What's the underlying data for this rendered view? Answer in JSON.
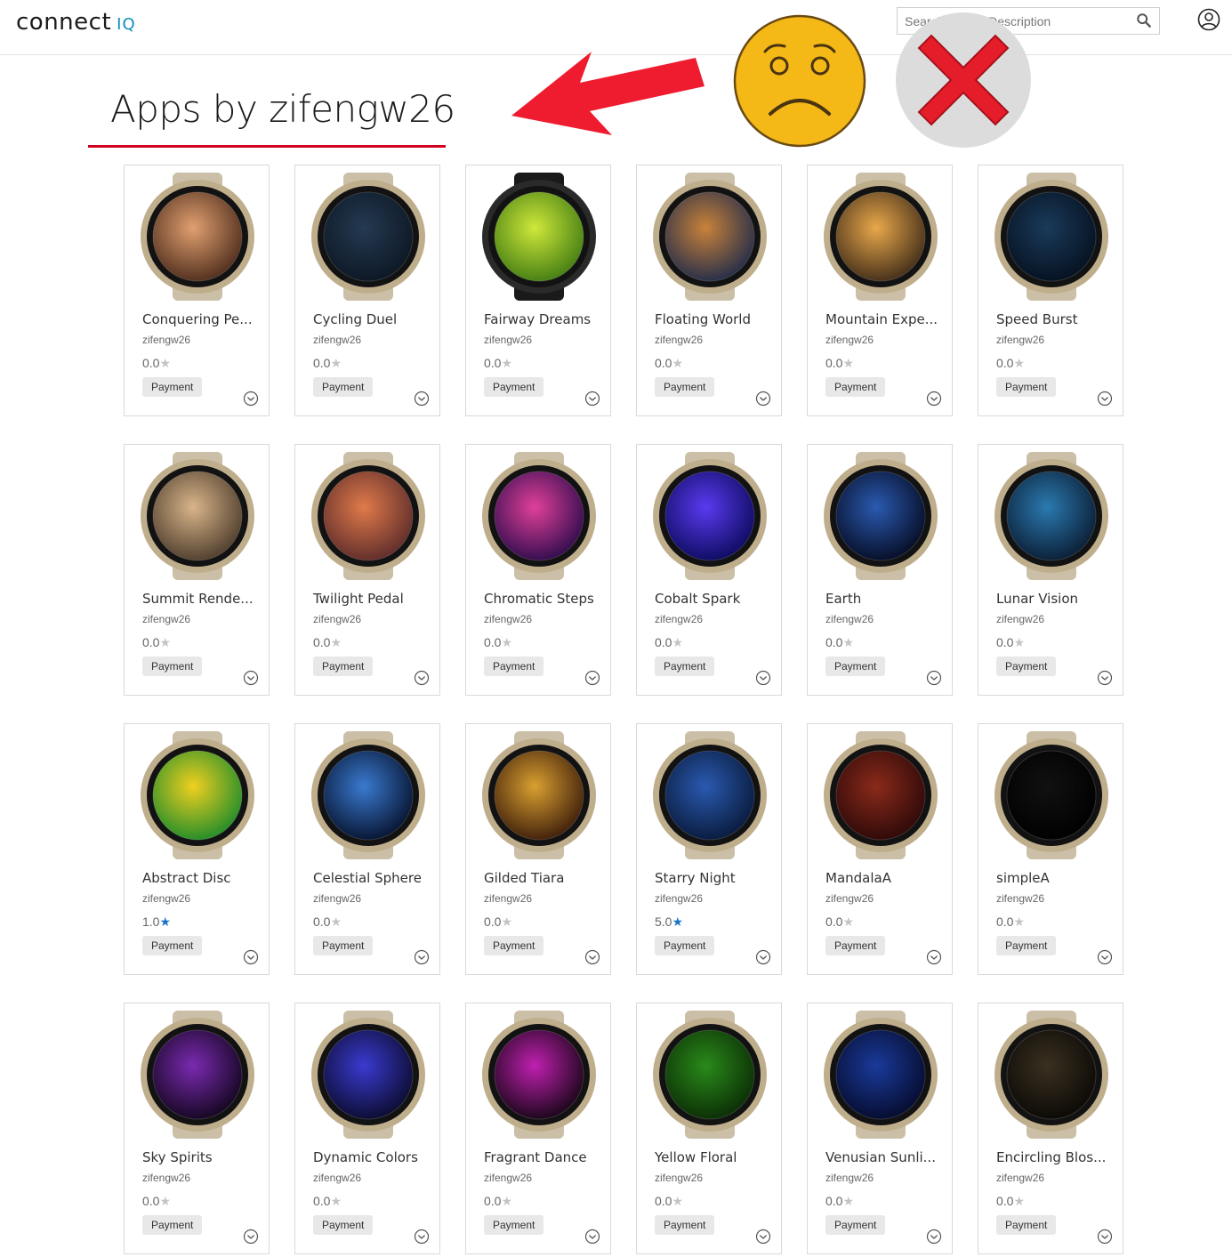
{
  "header": {
    "logo_main": "connect",
    "logo_iq": "IQ",
    "search_placeholder": "Search Title or Description",
    "search_value": ""
  },
  "page": {
    "title": "Apps by zifengw26"
  },
  "colors": {
    "accent_red": "#d1001f",
    "star_filled": "#1a73c9",
    "star_empty": "#c4c4c4"
  },
  "apps": [
    {
      "name": "Conquering Pe...",
      "developer": "zifengw26",
      "rating": "0.0",
      "filled": false,
      "badge": "Payment",
      "face": [
        "#e1a070",
        "#4a2a1a"
      ],
      "strap": "light"
    },
    {
      "name": "Cycling Duel",
      "developer": "zifengw26",
      "rating": "0.0",
      "filled": false,
      "badge": "Payment",
      "face": [
        "#243a52",
        "#0c1622"
      ],
      "strap": "light"
    },
    {
      "name": "Fairway Dreams",
      "developer": "zifengw26",
      "rating": "0.0",
      "filled": false,
      "badge": "Payment",
      "face": [
        "#cfe83a",
        "#3f7a12"
      ],
      "strap": "dark"
    },
    {
      "name": "Floating World",
      "developer": "zifengw26",
      "rating": "0.0",
      "filled": false,
      "badge": "Payment",
      "face": [
        "#c9823a",
        "#1e2a4a"
      ],
      "strap": "light"
    },
    {
      "name": "Mountain Expe...",
      "developer": "zifengw26",
      "rating": "0.0",
      "filled": false,
      "badge": "Payment",
      "face": [
        "#e9a84a",
        "#3d2a18"
      ],
      "strap": "light"
    },
    {
      "name": "Speed Burst",
      "developer": "zifengw26",
      "rating": "0.0",
      "filled": false,
      "badge": "Payment",
      "face": [
        "#1a3a5a",
        "#05101e"
      ],
      "strap": "light"
    },
    {
      "name": "Summit Rende...",
      "developer": "zifengw26",
      "rating": "0.0",
      "filled": false,
      "badge": "Payment",
      "face": [
        "#d9b58a",
        "#4a3a2a"
      ],
      "strap": "light"
    },
    {
      "name": "Twilight Pedal",
      "developer": "zifengw26",
      "rating": "0.0",
      "filled": false,
      "badge": "Payment",
      "face": [
        "#e07a4a",
        "#5a2a2a"
      ],
      "strap": "light"
    },
    {
      "name": "Chromatic Steps",
      "developer": "zifengw26",
      "rating": "0.0",
      "filled": false,
      "badge": "Payment",
      "face": [
        "#e0409a",
        "#2a0a4a"
      ],
      "strap": "light"
    },
    {
      "name": "Cobalt Spark",
      "developer": "zifengw26",
      "rating": "0.0",
      "filled": false,
      "badge": "Payment",
      "face": [
        "#5a3af0",
        "#0a0a5a"
      ],
      "strap": "light"
    },
    {
      "name": "Earth",
      "developer": "zifengw26",
      "rating": "0.0",
      "filled": false,
      "badge": "Payment",
      "face": [
        "#2a5ab0",
        "#050a20"
      ],
      "strap": "light"
    },
    {
      "name": "Lunar Vision",
      "developer": "zifengw26",
      "rating": "0.0",
      "filled": false,
      "badge": "Payment",
      "face": [
        "#2a7ab0",
        "#0a1a30"
      ],
      "strap": "light"
    },
    {
      "name": "Abstract Disc",
      "developer": "zifengw26",
      "rating": "1.0",
      "filled": true,
      "badge": "Payment",
      "face": [
        "#f0d020",
        "#1a8a2a"
      ],
      "strap": "light"
    },
    {
      "name": "Celestial Sphere",
      "developer": "zifengw26",
      "rating": "0.0",
      "filled": false,
      "badge": "Payment",
      "face": [
        "#3a7ad0",
        "#05102a"
      ],
      "strap": "light"
    },
    {
      "name": "Gilded Tiara",
      "developer": "zifengw26",
      "rating": "0.0",
      "filled": false,
      "badge": "Payment",
      "face": [
        "#d9a030",
        "#3a1a0a"
      ],
      "strap": "light"
    },
    {
      "name": "Starry Night",
      "developer": "zifengw26",
      "rating": "5.0",
      "filled": true,
      "badge": "Payment",
      "face": [
        "#2a5ab0",
        "#081838"
      ],
      "strap": "light"
    },
    {
      "name": "MandalaA",
      "developer": "zifengw26",
      "rating": "0.0",
      "filled": false,
      "badge": "Payment",
      "face": [
        "#8a2a1a",
        "#2a0808"
      ],
      "strap": "light"
    },
    {
      "name": "simpleA",
      "developer": "zifengw26",
      "rating": "0.0",
      "filled": false,
      "badge": "Payment",
      "face": [
        "#111111",
        "#000000"
      ],
      "strap": "light"
    },
    {
      "name": "Sky Spirits",
      "developer": "zifengw26",
      "rating": "0.0",
      "filled": false,
      "badge": "Payment",
      "face": [
        "#7a2ab0",
        "#10051a"
      ],
      "strap": "light"
    },
    {
      "name": "Dynamic Colors",
      "developer": "zifengw26",
      "rating": "0.0",
      "filled": false,
      "badge": "Payment",
      "face": [
        "#3a3ad0",
        "#0a0a2a"
      ],
      "strap": "light"
    },
    {
      "name": "Fragrant Dance",
      "developer": "zifengw26",
      "rating": "0.0",
      "filled": false,
      "badge": "Payment",
      "face": [
        "#c020b0",
        "#120512"
      ],
      "strap": "light"
    },
    {
      "name": "Yellow Floral",
      "developer": "zifengw26",
      "rating": "0.0",
      "filled": false,
      "badge": "Payment",
      "face": [
        "#2a8a1a",
        "#0a2a05"
      ],
      "strap": "light"
    },
    {
      "name": "Venusian Sunli...",
      "developer": "zifengw26",
      "rating": "0.0",
      "filled": false,
      "badge": "Payment",
      "face": [
        "#1a3a9a",
        "#050a2a"
      ],
      "strap": "light"
    },
    {
      "name": "Encircling Blos...",
      "developer": "zifengw26",
      "rating": "0.0",
      "filled": false,
      "badge": "Payment",
      "face": [
        "#3a3020",
        "#0a0805"
      ],
      "strap": "light"
    }
  ]
}
